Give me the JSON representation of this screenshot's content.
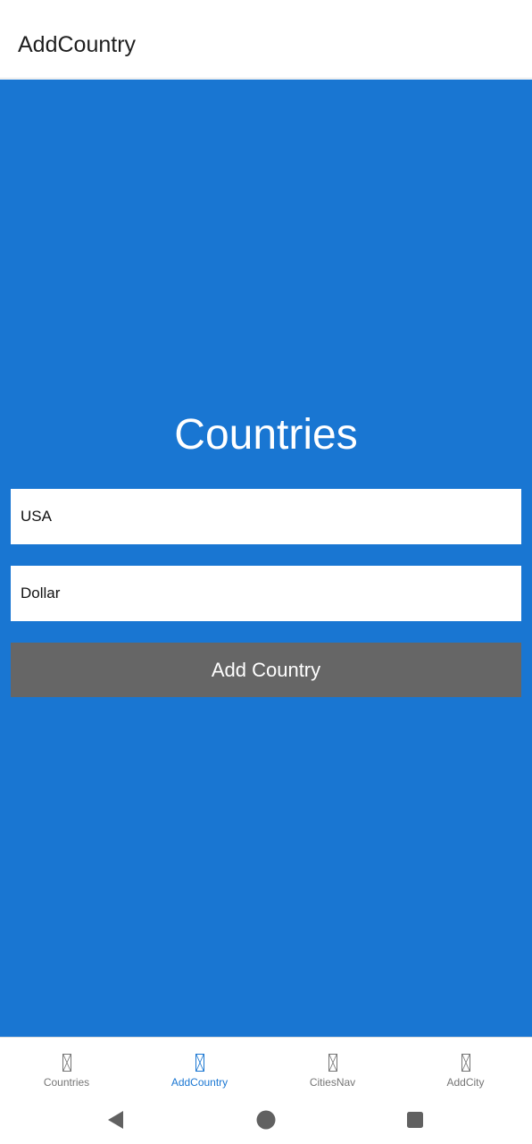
{
  "app_bar": {
    "title": "AddCountry"
  },
  "main": {
    "heading": "Countries",
    "country_name_value": "USA",
    "currency_value": "Dollar",
    "add_button_label": "Add Country"
  },
  "bottom_nav": {
    "items": [
      {
        "label": "Countries",
        "icon": "missing-glyph-icon",
        "active": false
      },
      {
        "label": "AddCountry",
        "icon": "missing-glyph-icon",
        "active": true
      },
      {
        "label": "CitiesNav",
        "icon": "missing-glyph-icon",
        "active": false
      },
      {
        "label": "AddCity",
        "icon": "missing-glyph-icon",
        "active": false
      }
    ]
  },
  "system_nav": {
    "icons": [
      "back-icon",
      "home-icon",
      "recents-icon"
    ]
  },
  "colors": {
    "accent": "#1976d2",
    "button": "#666666",
    "inactive": "#757575"
  }
}
